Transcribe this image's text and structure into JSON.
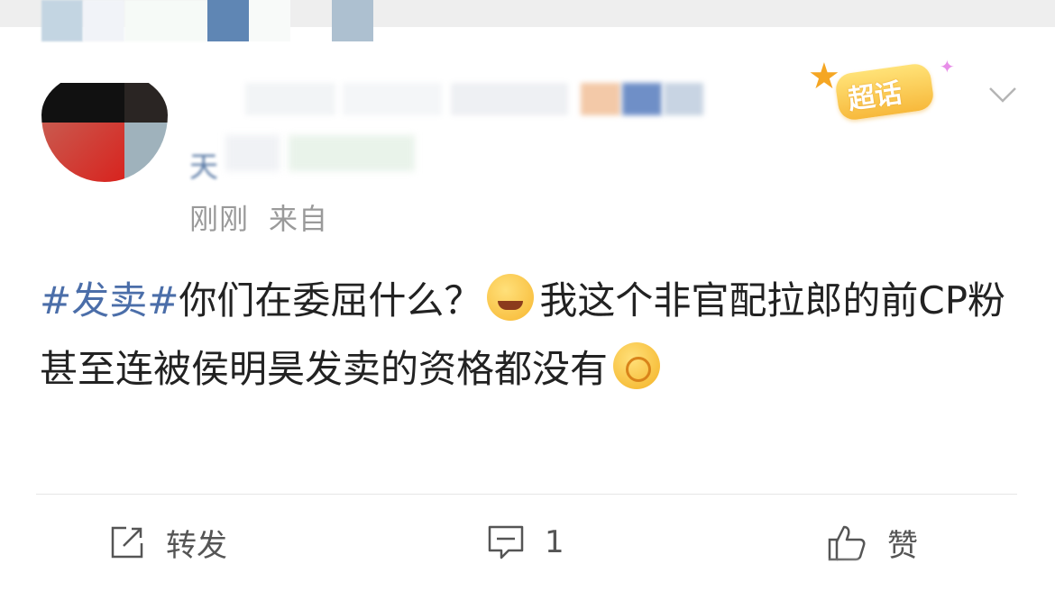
{
  "post": {
    "timestamp": "刚刚",
    "source_label": "来自",
    "supertopic_badge": "超话",
    "hashtag": "#发卖#",
    "text_part1": "你们在委屈什么？",
    "emoji_1": "grin-sweat-emoji",
    "text_part2": "我这个非官配拉郎的前CP粉甚至连被侯明昊发卖的资格都没有",
    "emoji_2": "dizzy-face-emoji"
  },
  "actions": {
    "repost_label": "转发",
    "comment_count": "1",
    "like_label": "赞"
  },
  "colors": {
    "hashtag": "#4b6ea9",
    "meta_gray": "#9a9a9a",
    "badge_yellow": "#f7b93c"
  }
}
